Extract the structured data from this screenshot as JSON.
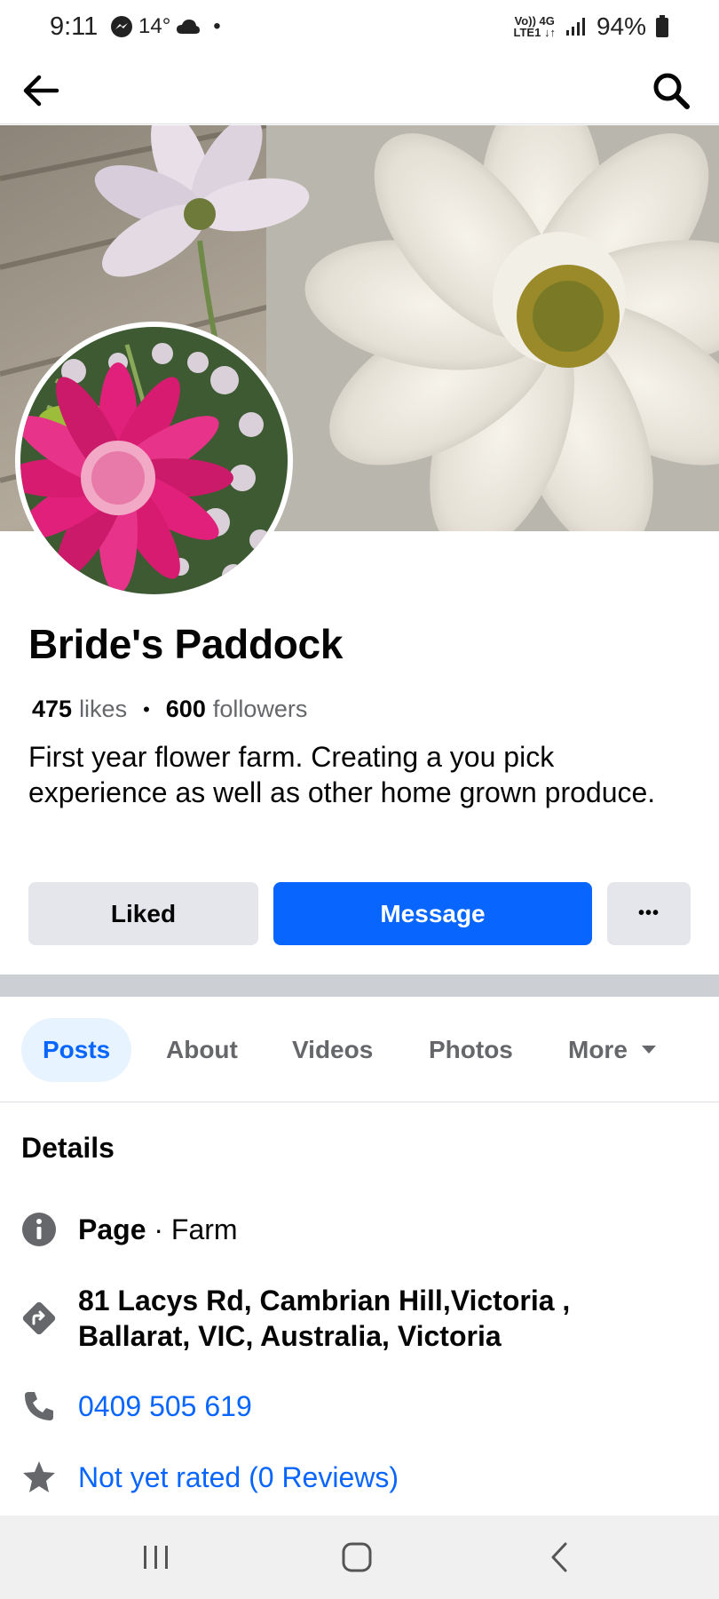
{
  "status_bar": {
    "time": "9:11",
    "temperature": "14°",
    "dot": "•",
    "network_top": "Vo)) 4G",
    "network_bottom": "LTE1 ↓↑",
    "battery": "94%"
  },
  "app_bar": {
    "back_icon": "arrow-left-icon",
    "search_icon": "search-icon"
  },
  "profile": {
    "name": "Bride's Paddock",
    "likes_count": "475",
    "likes_label": "likes",
    "separator": "•",
    "followers_count": "600",
    "followers_label": "followers",
    "bio_line1": "First year flower farm. Creating a you pick",
    "bio_line2": "experience as well as other home grown produce."
  },
  "actions": {
    "liked_label": "Liked",
    "message_label": "Message",
    "more_label": "•••"
  },
  "tabs": [
    {
      "label": "Posts",
      "active": true
    },
    {
      "label": "About",
      "active": false
    },
    {
      "label": "Videos",
      "active": false
    },
    {
      "label": "Photos",
      "active": false
    },
    {
      "label": "More",
      "active": false
    }
  ],
  "details": {
    "title": "Details",
    "page_type_label": "Page",
    "page_type_sep": " · ",
    "page_category": "Farm",
    "address_line1": "81 Lacys Rd, Cambrian Hill,Victoria ,",
    "address_line2": "Ballarat, VIC, Australia, Victoria",
    "phone": "0409 505 619",
    "rating": "Not yet rated (0 Reviews)"
  },
  "colors": {
    "brand_blue": "#0866ff",
    "secondary_button": "#e4e6eb",
    "muted_text": "#65676b",
    "divider": "#ccd0d5"
  }
}
